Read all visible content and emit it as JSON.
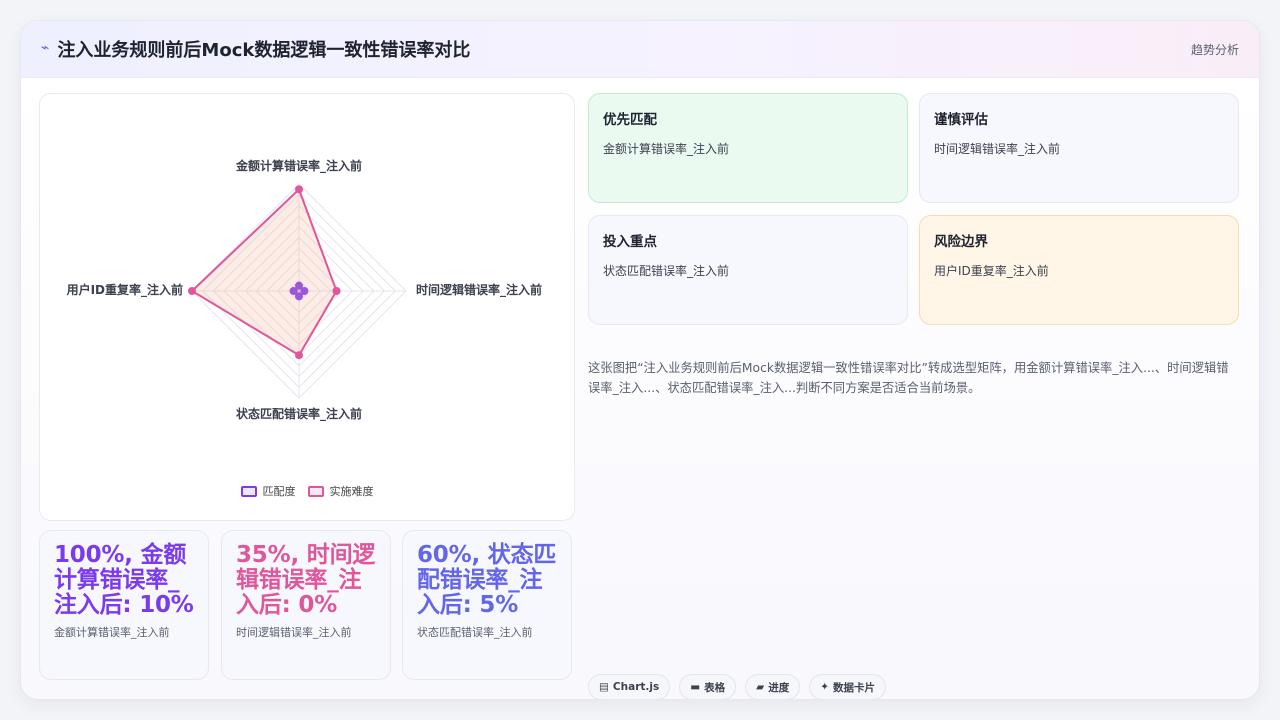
{
  "header": {
    "icon": "chart-line-icon",
    "title": "注入业务规则前后Mock数据逻辑一致性错误率对比",
    "right_label": "趋势分析"
  },
  "chart_data": {
    "type": "radar",
    "axes": [
      "金额计算错误率_注入前",
      "时间逻辑错误率_注入前",
      "状态匹配错误率_注入前",
      "用户ID重复率_注入前"
    ],
    "series": [
      {
        "name": "匹配度",
        "values": [
          5,
          5,
          5,
          5
        ],
        "color": "#7c3aed"
      },
      {
        "name": "实施难度",
        "values": [
          95,
          35,
          60,
          100
        ],
        "color": "#e0569b"
      }
    ],
    "rmax": 100,
    "rings": 10,
    "grid": true,
    "legend_position": "bottom"
  },
  "metrics": [
    {
      "value": "100%, 金额计算错误率_注入后: 10%",
      "label": "金额计算错误率_注入前",
      "color": "#7c3aed"
    },
    {
      "value": "35%, 时间逻辑错误率_注入后: 0%",
      "label": "时间逻辑错误率_注入前",
      "color": "#e0569b"
    },
    {
      "value": "60%, 状态匹配错误率_注入后: 5%",
      "label": "状态匹配错误率_注入前",
      "color": "#6366e8"
    }
  ],
  "cards": [
    {
      "title": "优先匹配",
      "text": "金额计算错误率_注入前",
      "bg": "#eafaf1",
      "border": "#bfeccf"
    },
    {
      "title": "谨慎评估",
      "text": "时间逻辑错误率_注入前",
      "bg": "#f7f8fd",
      "border": "#e6e8f2"
    },
    {
      "title": "投入重点",
      "text": "状态匹配错误率_注入前",
      "bg": "#f7f8fd",
      "border": "#e6e8f2"
    },
    {
      "title": "风险边界",
      "text": "用户ID重复率_注入前",
      "bg": "#fff6e8",
      "border": "#f6dcae"
    }
  ],
  "description": "这张图把“注入业务规则前后Mock数据逻辑一致性错误率对比”转成选型矩阵，用金额计算错误率_注入...、时间逻辑错误率_注入...、状态匹配错误率_注入...判断不同方案是否适合当前场景。",
  "tags": [
    {
      "icon": "chart-icon",
      "glyph": "▤",
      "label": "Chart.js"
    },
    {
      "icon": "table-icon",
      "glyph": "▬",
      "label": "表格"
    },
    {
      "icon": "progress-icon",
      "glyph": "▰",
      "label": "进度"
    },
    {
      "icon": "sparkle-icon",
      "glyph": "✦",
      "label": "数据卡片"
    }
  ]
}
